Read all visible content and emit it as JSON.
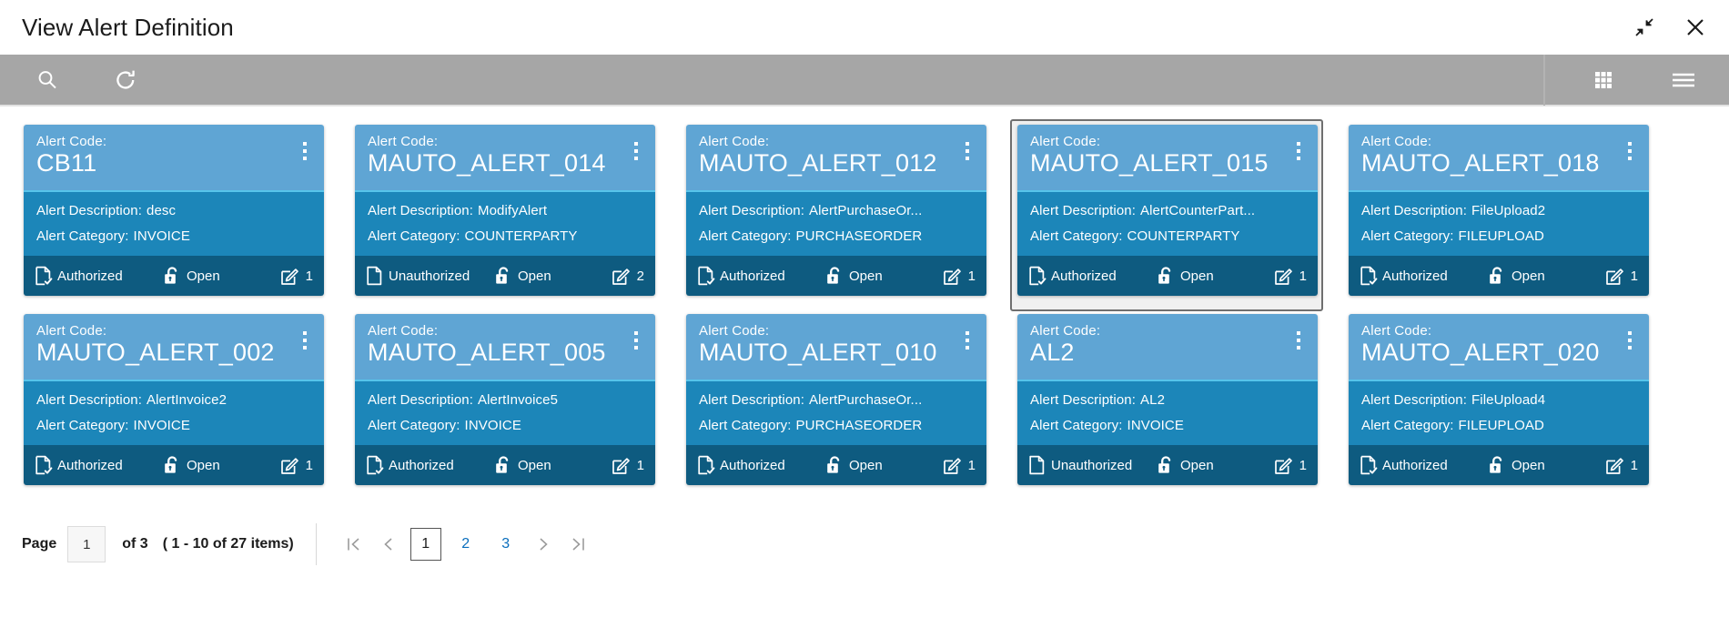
{
  "window": {
    "title": "View Alert Definition",
    "minimize_icon": "collapse-arrows-icon",
    "close_icon": "close-icon"
  },
  "toolbar": {
    "search_icon": "search-icon",
    "refresh_icon": "refresh-icon",
    "grid_view_icon": "grid-view-icon",
    "menu_icon": "hamburger-menu-icon"
  },
  "labels": {
    "alert_code": "Alert Code:",
    "alert_description": "Alert Description:",
    "alert_category": "Alert Category:"
  },
  "colors": {
    "card_header": "#5fa5d4",
    "card_body": "#1c86b9",
    "card_footer": "#0e5b80",
    "divider": "#57c4ea",
    "toolbar": "#a6a6a6",
    "link": "#0a6ebd"
  },
  "cards": [
    {
      "code": "CB11",
      "description": "desc",
      "category": "INVOICE",
      "status": "Authorized",
      "status_icon": "document-check-icon",
      "lock": "Open",
      "lock_icon": "open-padlock-icon",
      "edit_icon": "edit-pencil-icon",
      "version": "1",
      "selected": false
    },
    {
      "code": "MAUTO_ALERT_014",
      "description": "ModifyAlert",
      "category": "COUNTERPARTY",
      "status": "Unauthorized",
      "status_icon": "document-icon",
      "lock": "Open",
      "lock_icon": "open-padlock-icon",
      "edit_icon": "edit-pencil-icon",
      "version": "2",
      "selected": false
    },
    {
      "code": "MAUTO_ALERT_012",
      "description": "AlertPurchaseOr...",
      "category": "PURCHASEORDER",
      "status": "Authorized",
      "status_icon": "document-check-icon",
      "lock": "Open",
      "lock_icon": "open-padlock-icon",
      "edit_icon": "edit-pencil-icon",
      "version": "1",
      "selected": false
    },
    {
      "code": "MAUTO_ALERT_015",
      "description": "AlertCounterPart...",
      "category": "COUNTERPARTY",
      "status": "Authorized",
      "status_icon": "document-check-icon",
      "lock": "Open",
      "lock_icon": "open-padlock-icon",
      "edit_icon": "edit-pencil-icon",
      "version": "1",
      "selected": true
    },
    {
      "code": "MAUTO_ALERT_018",
      "description": "FileUpload2",
      "category": "FILEUPLOAD",
      "status": "Authorized",
      "status_icon": "document-check-icon",
      "lock": "Open",
      "lock_icon": "open-padlock-icon",
      "edit_icon": "edit-pencil-icon",
      "version": "1",
      "selected": false
    },
    {
      "code": "MAUTO_ALERT_002",
      "description": "AlertInvoice2",
      "category": "INVOICE",
      "status": "Authorized",
      "status_icon": "document-check-icon",
      "lock": "Open",
      "lock_icon": "open-padlock-icon",
      "edit_icon": "edit-pencil-icon",
      "version": "1",
      "selected": false
    },
    {
      "code": "MAUTO_ALERT_005",
      "description": "AlertInvoice5",
      "category": "INVOICE",
      "status": "Authorized",
      "status_icon": "document-check-icon",
      "lock": "Open",
      "lock_icon": "open-padlock-icon",
      "edit_icon": "edit-pencil-icon",
      "version": "1",
      "selected": false
    },
    {
      "code": "MAUTO_ALERT_010",
      "description": "AlertPurchaseOr...",
      "category": "PURCHASEORDER",
      "status": "Authorized",
      "status_icon": "document-check-icon",
      "lock": "Open",
      "lock_icon": "open-padlock-icon",
      "edit_icon": "edit-pencil-icon",
      "version": "1",
      "selected": false
    },
    {
      "code": "AL2",
      "description": "AL2",
      "category": "INVOICE",
      "status": "Unauthorized",
      "status_icon": "document-icon",
      "lock": "Open",
      "lock_icon": "open-padlock-icon",
      "edit_icon": "edit-pencil-icon",
      "version": "1",
      "selected": false
    },
    {
      "code": "MAUTO_ALERT_020",
      "description": "FileUpload4",
      "category": "FILEUPLOAD",
      "status": "Authorized",
      "status_icon": "document-check-icon",
      "lock": "Open",
      "lock_icon": "open-padlock-icon",
      "edit_icon": "edit-pencil-icon",
      "version": "1",
      "selected": false
    }
  ],
  "pagination": {
    "page_label": "Page",
    "page_value": "1",
    "of_text": "of 3",
    "range_text": "( 1 - 10 of 27 items)",
    "first_icon": "first-page-icon",
    "prev_icon": "previous-page-icon",
    "next_icon": "next-page-icon",
    "last_icon": "last-page-icon",
    "pages": [
      "1",
      "2",
      "3"
    ],
    "current_page": "1"
  }
}
